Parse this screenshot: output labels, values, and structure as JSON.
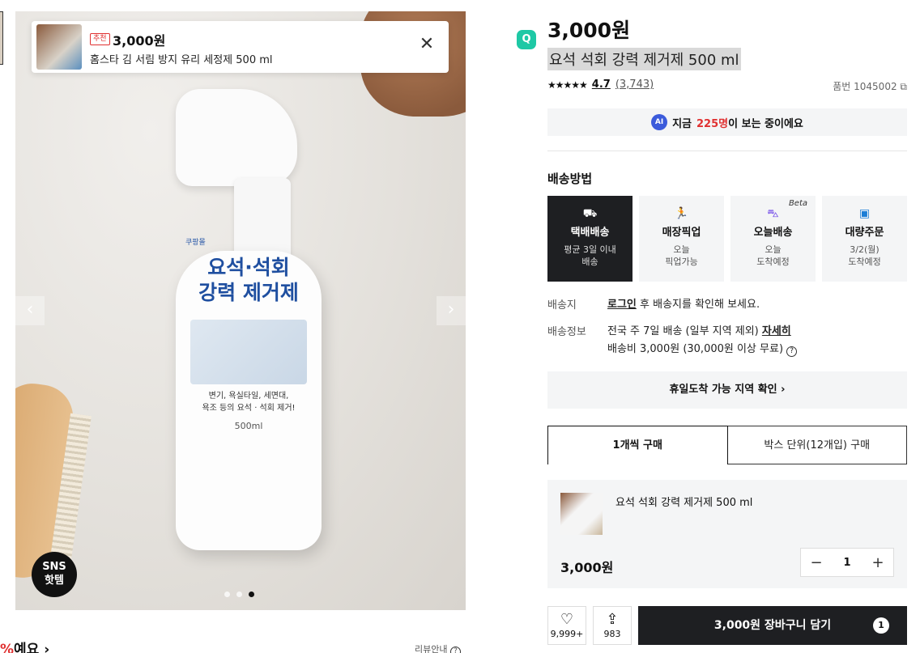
{
  "recommend": {
    "badge": "추천",
    "price": "3,000원",
    "name": "홈스타 김 서림 방지 유리 세정제 500 ml",
    "close": "✕"
  },
  "gallery": {
    "prev": "‹",
    "next": "›",
    "sns_line1": "SNS",
    "sns_line2": "핫템",
    "bottle_brand": "쿠팡몰",
    "bottle_title_1": "요석·석회",
    "bottle_title_2": "강력 제거제",
    "bottle_desc_1": "변기, 욕실타일, 세면대,",
    "bottle_desc_2": "욕조 등의 요석 · 석회 제거!",
    "bottle_volume": "500ml",
    "dots": 3,
    "active_dot": 2
  },
  "bottom": {
    "pct": "%",
    "label": "예요",
    "arrow": "›",
    "review_guide": "리뷰안내"
  },
  "product": {
    "logo": "Q",
    "price": "3,000원",
    "title": "요석 석회 강력 제거제 500 ml",
    "stars": "★★★★★",
    "score": "4.7",
    "review_count": "(3,743)",
    "sku": "품번 1045002"
  },
  "viewing": {
    "ai": "AI",
    "prefix": "지금",
    "count": "225명",
    "suffix": "이 보는 중이에요"
  },
  "shipping": {
    "heading": "배송방법",
    "options": [
      {
        "icon": "truck-icon",
        "title": "택배배송",
        "sub1": "평균 3일 이내",
        "sub2": "배송",
        "active": true
      },
      {
        "icon": "runner-icon",
        "title": "매장픽업",
        "sub1": "오늘",
        "sub2": "픽업가능",
        "active": false
      },
      {
        "icon": "scooter-icon",
        "title": "오늘배송",
        "sub1": "오늘",
        "sub2": "도착예정",
        "active": false,
        "badge": "Beta"
      },
      {
        "icon": "box-icon",
        "title": "대량주문",
        "sub1": "3/2(월)",
        "sub2": "도착예정",
        "active": false
      }
    ],
    "dest_label": "배송지",
    "dest_login": "로그인",
    "dest_text": " 후 배송지를 확인해 보세요.",
    "info_label": "배송정보",
    "info_text": "전국 주 7일 배송 (일부 지역 제외) ",
    "info_detail": "자세히",
    "fee_text": "배송비 3,000원 (30,000원 이상 무료) ",
    "help": "?",
    "holiday": "휴일도착 가능 지역 확인"
  },
  "tabs": [
    {
      "label": "1개씩 구매",
      "active": true
    },
    {
      "label": "박스 단위(12개입) 구매",
      "active": false
    }
  ],
  "selection": {
    "name": "요석 석회 강력 제거제 500 ml",
    "price": "3,000원",
    "minus": "−",
    "qty": "1",
    "plus": "+"
  },
  "actions": {
    "like_count": "9,999+",
    "share_count": "983",
    "cart_label": "3,000원 장바구니 담기",
    "cart_count": "1"
  }
}
